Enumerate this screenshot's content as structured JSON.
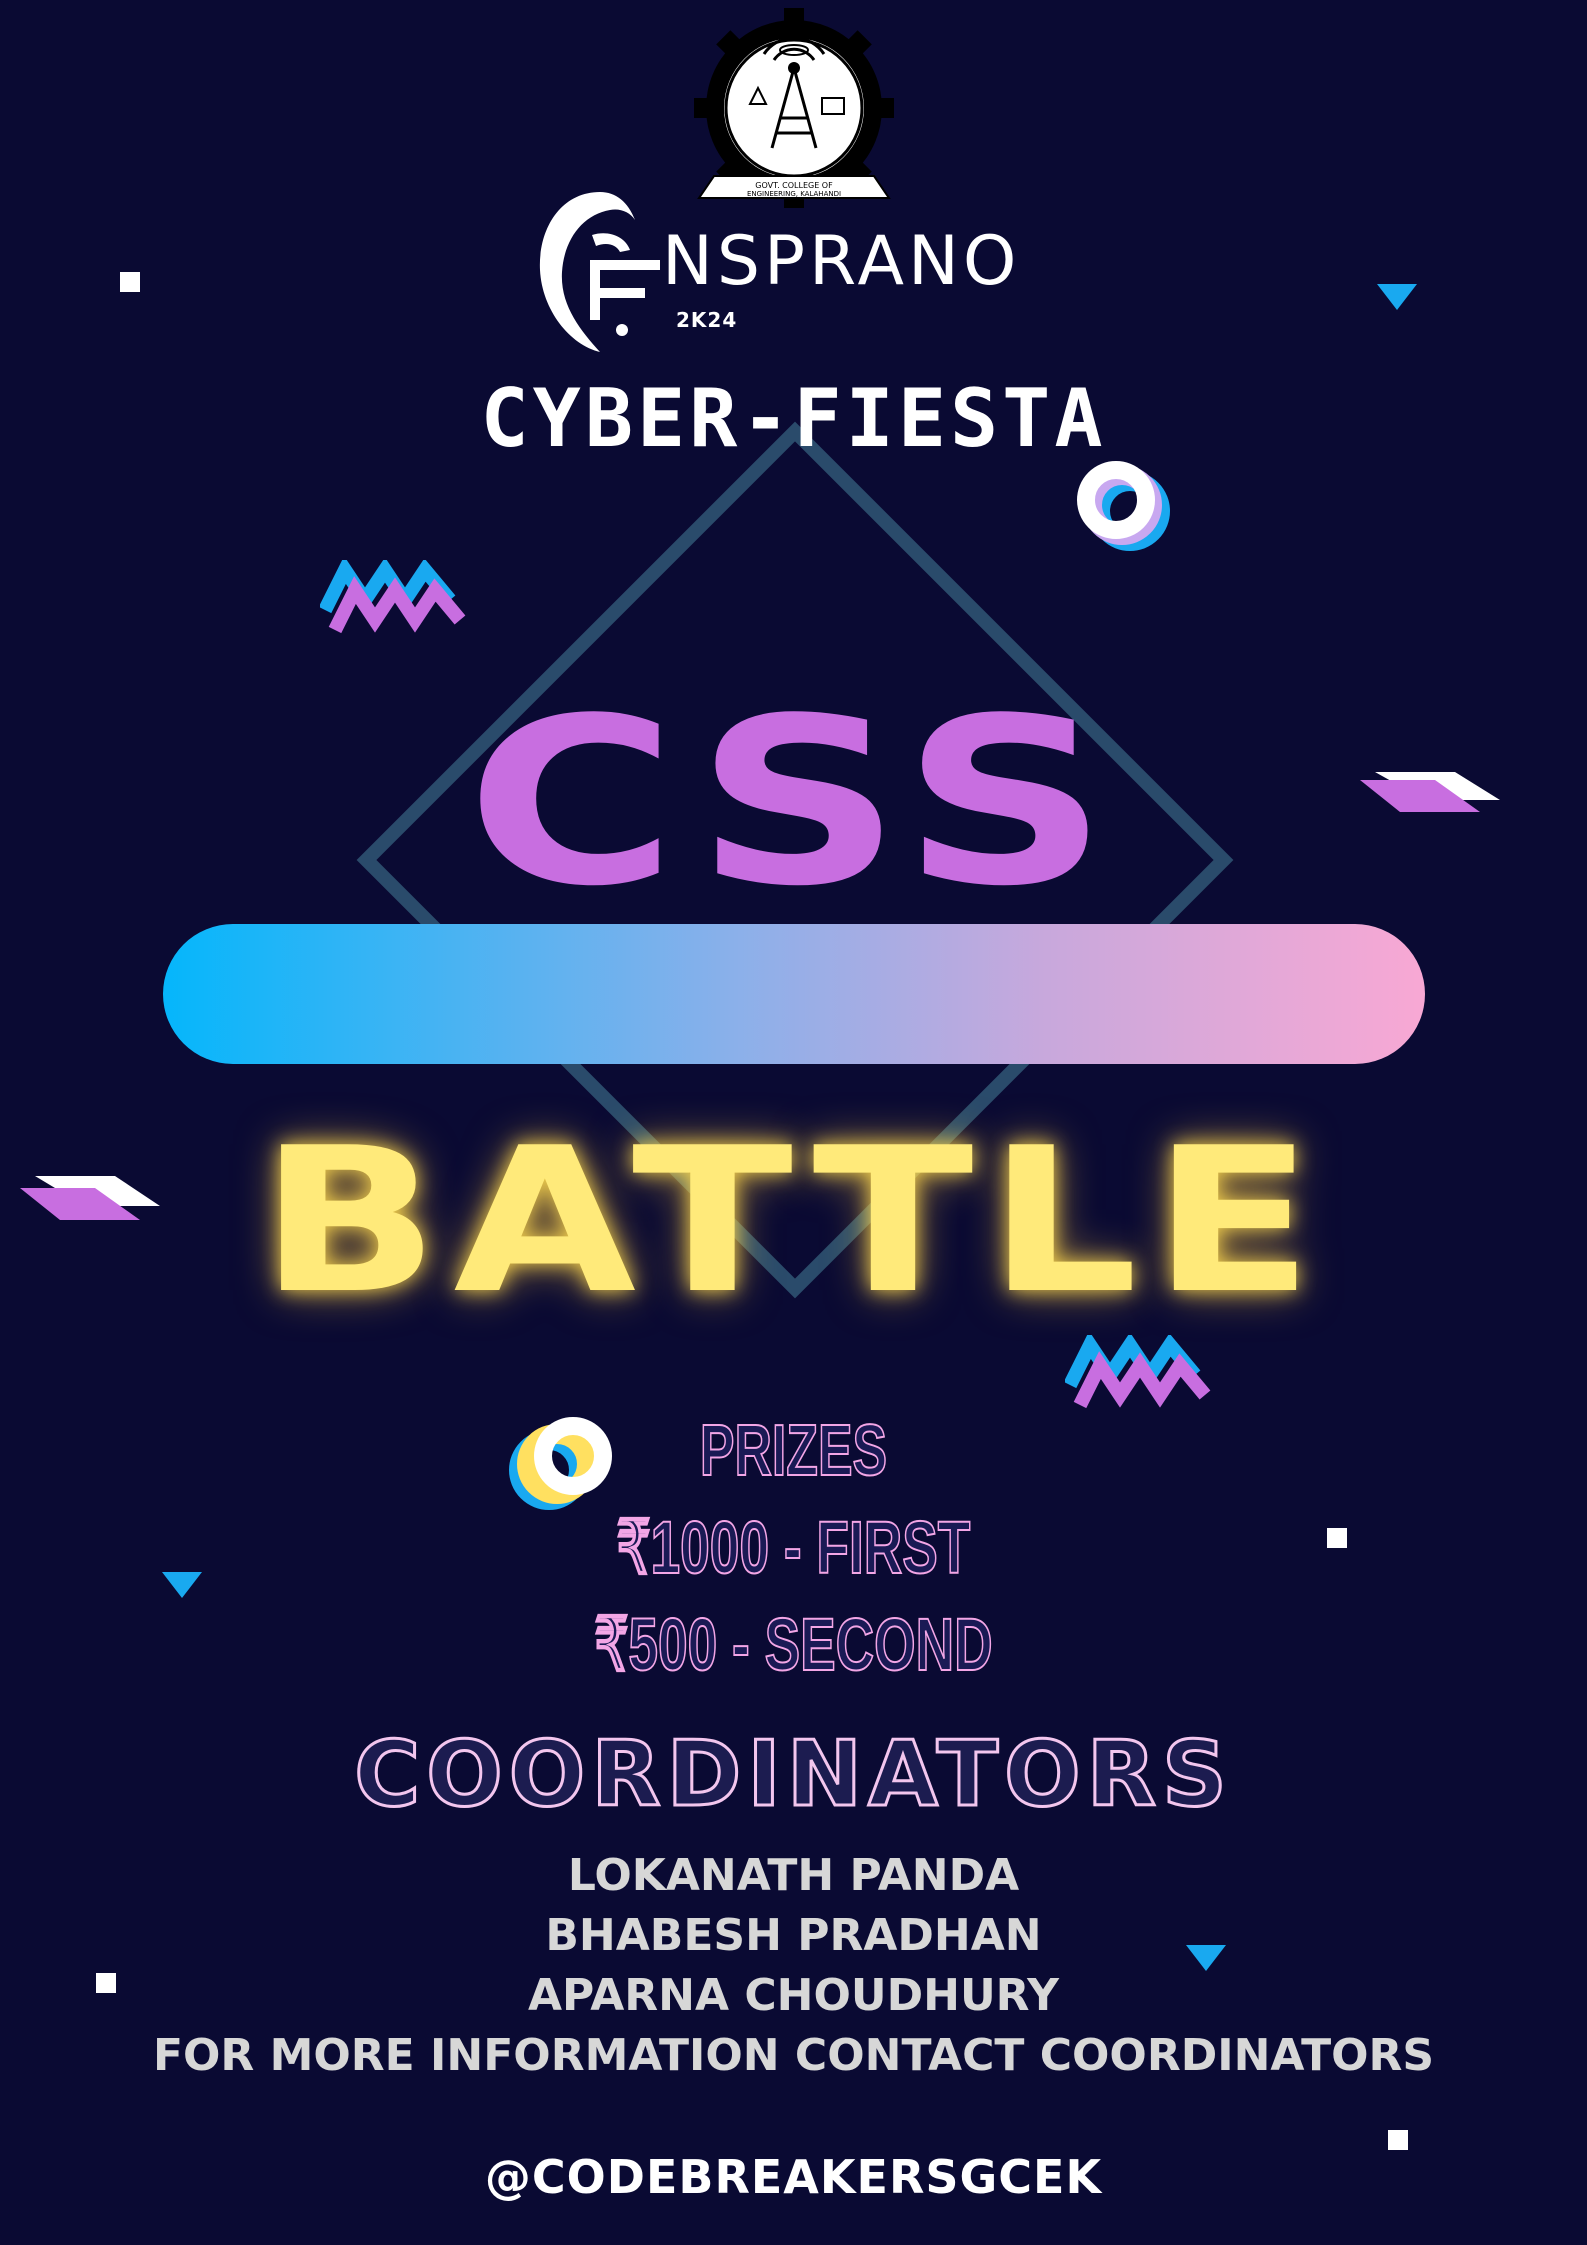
{
  "logo": {
    "college_seal_text": "GOVT. COLLEGE OF ENGINEERING, KALAHANDI",
    "brand_name": "NSPRANO",
    "brand_year": "2K24"
  },
  "event_title": "CYBER-FIESTA",
  "headline": {
    "word1": "CSS",
    "word2": "BATTLE"
  },
  "prizes": {
    "heading": "PRIZES",
    "first": "₹1000 - FIRST",
    "second": "₹500 - SECOND"
  },
  "coordinators": {
    "heading": "COORDINATORS",
    "names": [
      "LOKANATH PANDA",
      "BHABESH PRADHAN",
      "APARNA CHOUDHURY"
    ],
    "note": "FOR MORE INFORMATION CONTACT COORDINATORS"
  },
  "handle": "@CODEBREAKERSGCEK",
  "colors": {
    "background": "#0a0a33",
    "css_word": "#c86ee0",
    "battle_word": "#ffea7a",
    "outline_pink": "#f3a6e6",
    "accent_blue": "#19a9f0",
    "names_gray": "#d7d7d7"
  }
}
